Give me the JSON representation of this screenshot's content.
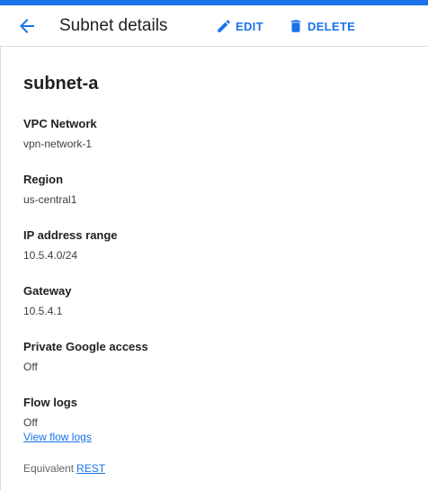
{
  "header": {
    "title": "Subnet details",
    "edit_label": "EDIT",
    "delete_label": "DELETE",
    "back_icon": "arrow-back-icon",
    "edit_icon": "pencil-icon",
    "delete_icon": "trash-icon"
  },
  "subnet": {
    "name": "subnet-a",
    "fields": [
      {
        "label": "VPC Network",
        "value": "vpn-network-1"
      },
      {
        "label": "Region",
        "value": "us-central1"
      },
      {
        "label": "IP address range",
        "value": "10.5.4.0/24"
      },
      {
        "label": "Gateway",
        "value": "10.5.4.1"
      },
      {
        "label": "Private Google access",
        "value": "Off"
      },
      {
        "label": "Flow logs",
        "value": "Off"
      }
    ],
    "flow_logs_link": "View flow logs"
  },
  "footer": {
    "equivalent_label": "Equivalent",
    "rest_link": "REST"
  },
  "colors": {
    "accent": "#1a73e8",
    "text": "#202124",
    "secondary_text": "#5f6368",
    "divider": "#dadce0"
  }
}
